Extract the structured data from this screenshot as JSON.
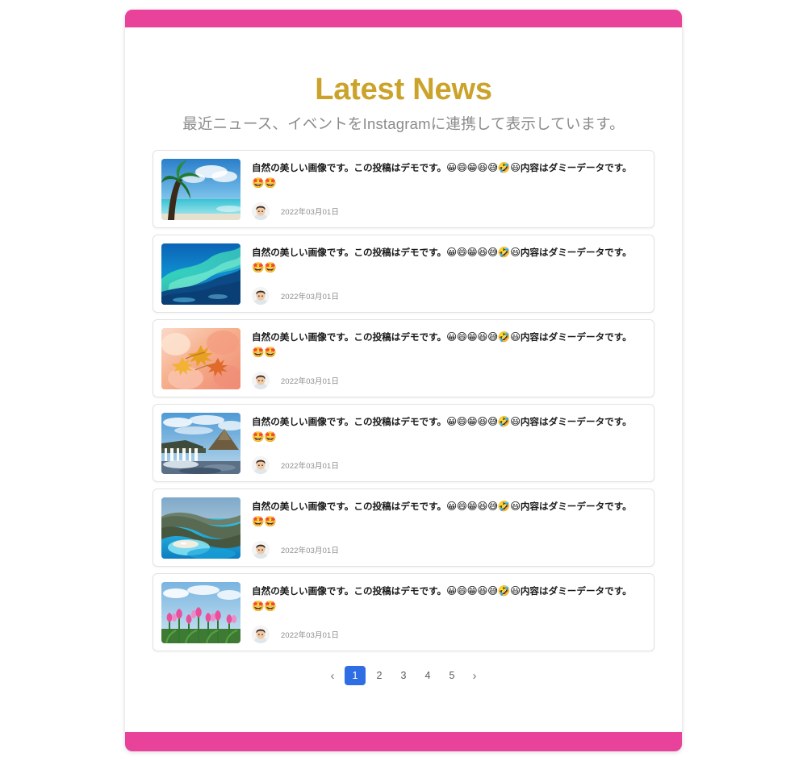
{
  "theme": {
    "accent_pink": "#e8429b",
    "title_gold": "#cba32a",
    "pagination_active_blue": "#2f6de4",
    "subtitle_gray": "#8b8b8b",
    "card_border": "#e3e3e3"
  },
  "header": {
    "title": "Latest News",
    "subtitle": "最近ニュース、イベントをInstagramに連携して表示しています。"
  },
  "post_common": {
    "text_line1": "自然の美しい画像です。この投稿はデモです。",
    "emojis_line1": "😀😄😁😆😅🤣😃",
    "text_line2": "内容はダミーデータです。",
    "emojis_line2": "🤩🤩",
    "date": "2022年03月01日",
    "avatar_name": "user-avatar"
  },
  "posts": [
    {
      "image_name": "tropical-beach-palm-tree",
      "text_line1": "自然の美しい画像です。この投稿はデモです。",
      "emojis_line1": "😀😄😁😆😅🤣😃",
      "text_line2": "内容はダミーデータです。",
      "emojis_line2": "🤩🤩",
      "date": "2022年03月01日"
    },
    {
      "image_name": "aurora-borealis-over-sea",
      "text_line1": "自然の美しい画像です。この投稿はデモです。",
      "emojis_line1": "😀😄😁😆😅🤣😃",
      "text_line2": "内容はダミーデータです。",
      "emojis_line2": "🤩🤩",
      "date": "2022年03月01日"
    },
    {
      "image_name": "autumn-maple-leaves",
      "text_line1": "自然の美しい画像です。この投稿はデモです。",
      "emojis_line1": "😀😄😁😆😅🤣😃",
      "text_line2": "内容はダミーデータです。",
      "emojis_line2": "🤩🤩",
      "date": "2022年03月01日"
    },
    {
      "image_name": "waterfall-and-mountain",
      "text_line1": "自然の美しい画像です。この投稿はデモです。",
      "emojis_line1": "😀😄😁😆😅🤣😃",
      "text_line2": "内容はダミーデータです。",
      "emojis_line2": "🤩🤩",
      "date": "2022年03月01日"
    },
    {
      "image_name": "coastal-cliff-lagoon",
      "text_line1": "自然の美しい画像です。この投稿はデモです。",
      "emojis_line1": "😀😄😁😆😅🤣😃",
      "text_line2": "内容はダミーデータです。",
      "emojis_line2": "🤩🤩",
      "date": "2022年03月01日"
    },
    {
      "image_name": "pink-tulip-field",
      "text_line1": "自然の美しい画像です。この投稿はデモです。",
      "emojis_line1": "😀😄😁😆😅🤣😃",
      "text_line2": "内容はダミーデータです。",
      "emojis_line2": "🤩🤩",
      "date": "2022年03月01日"
    }
  ],
  "pagination": {
    "prev_label": "‹",
    "next_label": "›",
    "pages": [
      "1",
      "2",
      "3",
      "4",
      "5"
    ],
    "active_index": 0
  }
}
